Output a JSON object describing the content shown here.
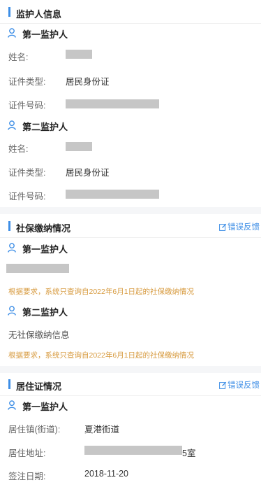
{
  "guardian_info": {
    "title": "监护人信息",
    "first": {
      "label": "第一监护人",
      "name_label": "姓名:",
      "id_type_label": "证件类型:",
      "id_type_value": "居民身份证",
      "id_number_label": "证件号码:"
    },
    "second": {
      "label": "第二监护人",
      "name_label": "姓名:",
      "id_type_label": "证件类型:",
      "id_type_value": "居民身份证",
      "id_number_label": "证件号码:"
    }
  },
  "social_security": {
    "title": "社保缴纳情况",
    "feedback_label": "错误反馈",
    "first": {
      "label": "第一监护人",
      "note": "根据要求，系统只查询自2022年6月1日起的社保缴纳情况"
    },
    "second": {
      "label": "第二监护人",
      "status": "无社保缴纳信息",
      "note": "根据要求，系统只查询自2022年6月1日起的社保缴纳情况"
    }
  },
  "residence_permit": {
    "title": "居住证情况",
    "feedback_label": "错误反馈",
    "first": {
      "label": "第一监护人",
      "town_label": "居住镇(街道):",
      "town_value": "夏港街道",
      "address_label": "居住地址:",
      "address_visible_suffix": "5室",
      "sign_date_label": "签注日期:",
      "sign_date_value": "2018-11-20"
    }
  },
  "colors": {
    "accent": "#3d8ee6",
    "note": "#d79a3e",
    "redaction": "#c6c6c6"
  }
}
